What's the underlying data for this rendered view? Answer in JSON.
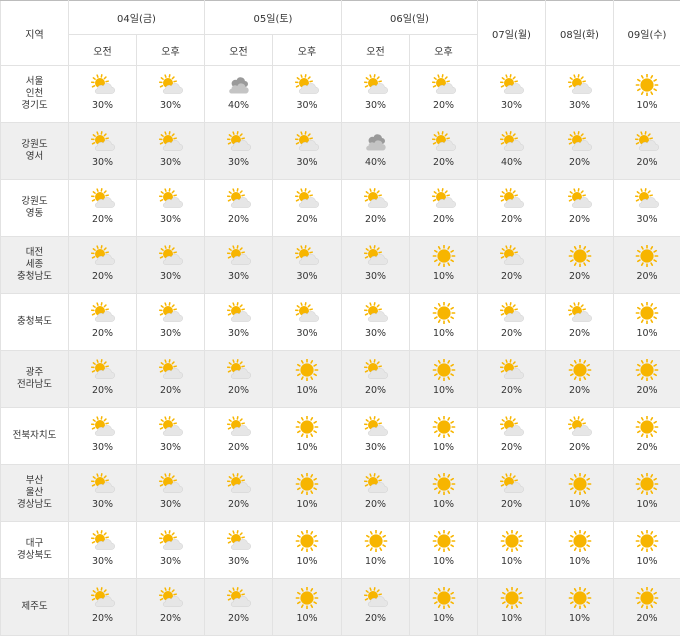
{
  "header": {
    "region_label": "지역",
    "days": [
      {
        "label": "04일(금)",
        "split": true
      },
      {
        "label": "05일(토)",
        "split": true
      },
      {
        "label": "06일(일)",
        "split": true
      },
      {
        "label": "07일(월)",
        "split": false
      },
      {
        "label": "08일(화)",
        "split": false
      },
      {
        "label": "09일(수)",
        "split": false
      }
    ],
    "am_label": "오전",
    "pm_label": "오후"
  },
  "icon_names": {
    "partly": "partly-cloudy-icon",
    "sunny": "sunny-icon",
    "cloudy": "cloudy-icon"
  },
  "colors": {
    "sun": "#f7b500",
    "cloud": "#e6e6e6",
    "dark_cloud": "#9a9a9a",
    "alt_row": "#efefef"
  },
  "rows": [
    {
      "region": [
        "서울",
        "인천",
        "경기도"
      ],
      "cells": [
        {
          "icon": "partly",
          "pct": "30%"
        },
        {
          "icon": "partly",
          "pct": "30%"
        },
        {
          "icon": "cloudy",
          "pct": "40%"
        },
        {
          "icon": "partly",
          "pct": "30%"
        },
        {
          "icon": "partly",
          "pct": "30%"
        },
        {
          "icon": "partly",
          "pct": "20%"
        },
        {
          "icon": "partly",
          "pct": "30%"
        },
        {
          "icon": "partly",
          "pct": "30%"
        },
        {
          "icon": "sunny",
          "pct": "10%"
        }
      ]
    },
    {
      "region": [
        "강원도",
        "영서"
      ],
      "cells": [
        {
          "icon": "partly",
          "pct": "30%"
        },
        {
          "icon": "partly",
          "pct": "30%"
        },
        {
          "icon": "partly",
          "pct": "30%"
        },
        {
          "icon": "partly",
          "pct": "30%"
        },
        {
          "icon": "cloudy",
          "pct": "40%"
        },
        {
          "icon": "partly",
          "pct": "20%"
        },
        {
          "icon": "partly",
          "pct": "40%"
        },
        {
          "icon": "partly",
          "pct": "20%"
        },
        {
          "icon": "partly",
          "pct": "20%"
        }
      ]
    },
    {
      "region": [
        "강원도",
        "영동"
      ],
      "cells": [
        {
          "icon": "partly",
          "pct": "20%"
        },
        {
          "icon": "partly",
          "pct": "30%"
        },
        {
          "icon": "partly",
          "pct": "20%"
        },
        {
          "icon": "partly",
          "pct": "20%"
        },
        {
          "icon": "partly",
          "pct": "20%"
        },
        {
          "icon": "partly",
          "pct": "20%"
        },
        {
          "icon": "partly",
          "pct": "20%"
        },
        {
          "icon": "partly",
          "pct": "20%"
        },
        {
          "icon": "partly",
          "pct": "30%"
        }
      ]
    },
    {
      "region": [
        "대전",
        "세종",
        "충청남도"
      ],
      "cells": [
        {
          "icon": "partly",
          "pct": "20%"
        },
        {
          "icon": "partly",
          "pct": "30%"
        },
        {
          "icon": "partly",
          "pct": "30%"
        },
        {
          "icon": "partly",
          "pct": "30%"
        },
        {
          "icon": "partly",
          "pct": "30%"
        },
        {
          "icon": "sunny",
          "pct": "10%"
        },
        {
          "icon": "partly",
          "pct": "20%"
        },
        {
          "icon": "sunny",
          "pct": "20%"
        },
        {
          "icon": "sunny",
          "pct": "20%"
        }
      ]
    },
    {
      "region": [
        "충청북도"
      ],
      "cells": [
        {
          "icon": "partly",
          "pct": "20%"
        },
        {
          "icon": "partly",
          "pct": "30%"
        },
        {
          "icon": "partly",
          "pct": "30%"
        },
        {
          "icon": "partly",
          "pct": "30%"
        },
        {
          "icon": "partly",
          "pct": "30%"
        },
        {
          "icon": "sunny",
          "pct": "10%"
        },
        {
          "icon": "partly",
          "pct": "20%"
        },
        {
          "icon": "partly",
          "pct": "20%"
        },
        {
          "icon": "sunny",
          "pct": "10%"
        }
      ]
    },
    {
      "region": [
        "광주",
        "전라남도"
      ],
      "cells": [
        {
          "icon": "partly",
          "pct": "20%"
        },
        {
          "icon": "partly",
          "pct": "20%"
        },
        {
          "icon": "partly",
          "pct": "20%"
        },
        {
          "icon": "sunny",
          "pct": "10%"
        },
        {
          "icon": "partly",
          "pct": "20%"
        },
        {
          "icon": "sunny",
          "pct": "10%"
        },
        {
          "icon": "partly",
          "pct": "20%"
        },
        {
          "icon": "sunny",
          "pct": "20%"
        },
        {
          "icon": "sunny",
          "pct": "20%"
        }
      ]
    },
    {
      "region": [
        "전북자치도"
      ],
      "cells": [
        {
          "icon": "partly",
          "pct": "30%"
        },
        {
          "icon": "partly",
          "pct": "30%"
        },
        {
          "icon": "partly",
          "pct": "20%"
        },
        {
          "icon": "sunny",
          "pct": "10%"
        },
        {
          "icon": "partly",
          "pct": "30%"
        },
        {
          "icon": "sunny",
          "pct": "10%"
        },
        {
          "icon": "partly",
          "pct": "20%"
        },
        {
          "icon": "partly",
          "pct": "20%"
        },
        {
          "icon": "sunny",
          "pct": "20%"
        }
      ]
    },
    {
      "region": [
        "부산",
        "울산",
        "경상남도"
      ],
      "cells": [
        {
          "icon": "partly",
          "pct": "30%"
        },
        {
          "icon": "partly",
          "pct": "30%"
        },
        {
          "icon": "partly",
          "pct": "20%"
        },
        {
          "icon": "sunny",
          "pct": "10%"
        },
        {
          "icon": "partly",
          "pct": "20%"
        },
        {
          "icon": "sunny",
          "pct": "10%"
        },
        {
          "icon": "partly",
          "pct": "20%"
        },
        {
          "icon": "sunny",
          "pct": "10%"
        },
        {
          "icon": "sunny",
          "pct": "10%"
        }
      ]
    },
    {
      "region": [
        "대구",
        "경상북도"
      ],
      "cells": [
        {
          "icon": "partly",
          "pct": "30%"
        },
        {
          "icon": "partly",
          "pct": "30%"
        },
        {
          "icon": "partly",
          "pct": "30%"
        },
        {
          "icon": "sunny",
          "pct": "10%"
        },
        {
          "icon": "sunny",
          "pct": "10%"
        },
        {
          "icon": "sunny",
          "pct": "10%"
        },
        {
          "icon": "sunny",
          "pct": "10%"
        },
        {
          "icon": "sunny",
          "pct": "10%"
        },
        {
          "icon": "sunny",
          "pct": "10%"
        }
      ]
    },
    {
      "region": [
        "제주도"
      ],
      "cells": [
        {
          "icon": "partly",
          "pct": "20%"
        },
        {
          "icon": "partly",
          "pct": "20%"
        },
        {
          "icon": "partly",
          "pct": "20%"
        },
        {
          "icon": "sunny",
          "pct": "10%"
        },
        {
          "icon": "partly",
          "pct": "20%"
        },
        {
          "icon": "sunny",
          "pct": "10%"
        },
        {
          "icon": "sunny",
          "pct": "10%"
        },
        {
          "icon": "sunny",
          "pct": "10%"
        },
        {
          "icon": "sunny",
          "pct": "20%"
        }
      ]
    }
  ]
}
